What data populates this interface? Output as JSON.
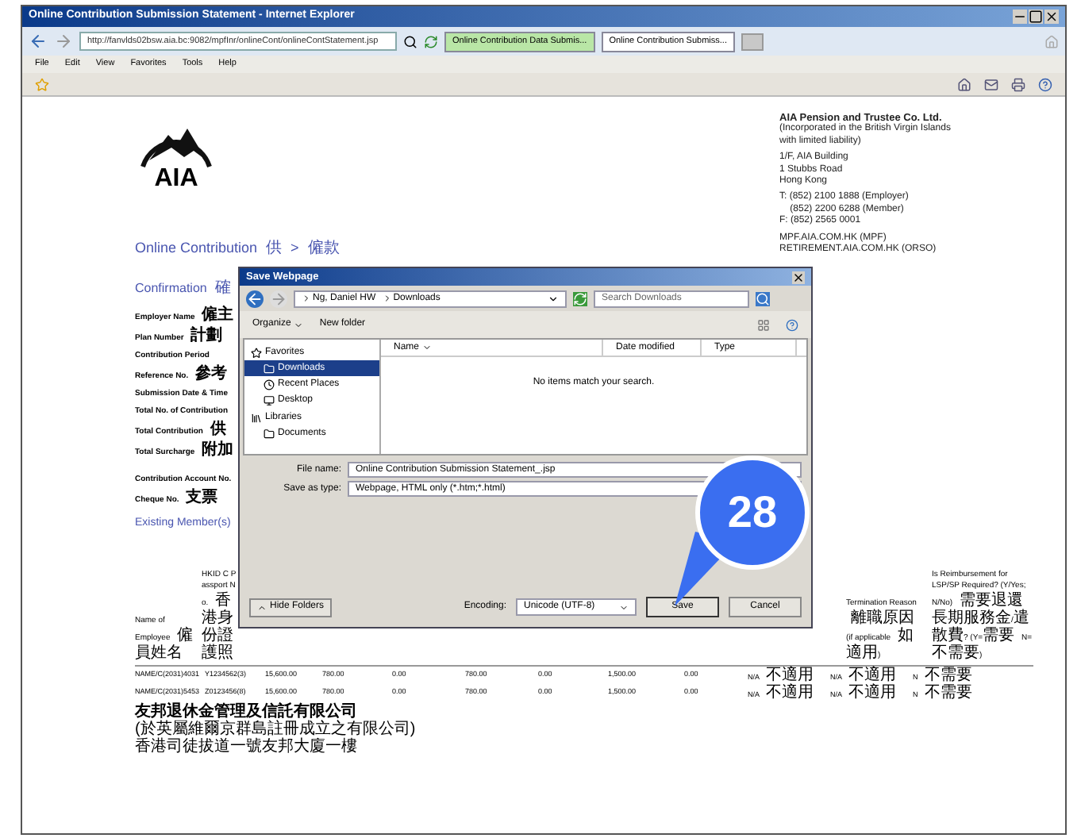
{
  "window": {
    "title": "Online Contribution Submission Statement - Internet Explorer"
  },
  "address_bar": {
    "url": "http://fanvlds02bsw.aia.bc:9082/mpfInr/onlineCont/onlineContStatement.jsp"
  },
  "tabs": [
    {
      "label": "Online Contribution Data Submis...",
      "selected": false
    },
    {
      "label": "Online Contribution Submiss...",
      "selected": true
    }
  ],
  "menu": [
    "File",
    "Edit",
    "View",
    "Favorites",
    "Tools",
    "Help"
  ],
  "page": {
    "logo_text": "AIA",
    "company": {
      "name": "AIA Pension and Trustee Co. Ltd.",
      "lines": [
        "(Incorporated in the British Virgin Islands",
        "with limited liability)",
        "1/F, AIA Building",
        "1 Stubbs Road",
        "Hong Kong",
        "T: (852) 2100 1888 (Employer)",
        "    (852) 2200 6288 (Member)",
        "F: (852) 2565 0001"
      ],
      "links": [
        "MPF.AIA.COM.HK (MPF)",
        "RETIREMENT.AIA.COM.HK (ORSO)"
      ]
    },
    "heading": "Online Contribution 供 > 僱款",
    "subheading": "Confirmation 確",
    "fields": [
      "Employer Name 僱主",
      "Plan Number 計劃",
      "Contribution Period",
      "Reference No. 參考",
      "Submission Date & Time",
      "Total No. of Contribution",
      "Total Contribution 供",
      "Total Surcharge 附加"
    ],
    "payment_fields": [
      "Contribution Account No.",
      "Cheque No. 支票"
    ],
    "section_title": "Existing Member(s)",
    "table": {
      "visible_headers": [
        "Name of Employee 僱員姓名",
        "HKID C Passport No. 香港身份證護照",
        "Termination Reason 離職原因 (if applicable 如適用)",
        "Is Reimbursement for LSP/SP Required? (Y/Yes; N/No) 需要退還長期服務金/遣散費? (Y=需要 N=不需要)"
      ],
      "rows": [
        [
          "NAME/C(2031)4031",
          "Y1234562(3)",
          "15,600.00",
          "780.00",
          "0.00",
          "780.00",
          "0.00",
          "1,500.00",
          "0.00",
          "N/A 不適用",
          "N/A 不適用",
          "N 不需要"
        ],
        [
          "NAME/C(2031)5453",
          "Z0123456(8)",
          "15,600.00",
          "780.00",
          "0.00",
          "780.00",
          "0.00",
          "1,500.00",
          "0.00",
          "N/A 不適用",
          "N/A 不適用",
          "N 不需要"
        ]
      ]
    },
    "footer_lines": [
      "友邦退休金管理及信託有限公司",
      "(於英屬維爾京群島註冊成立之有限公司)",
      "香港司徒拔道一號友邦大廈一樓"
    ]
  },
  "dialog": {
    "title": "Save Webpage",
    "path": [
      "Ng, Daniel HW",
      "Downloads"
    ],
    "search_placeholder": "Search Downloads",
    "toolbar": [
      "Organize",
      "New folder"
    ],
    "nav_items": [
      {
        "label": "Favorites",
        "kind": "group",
        "selected": false
      },
      {
        "label": "Downloads",
        "kind": "item",
        "selected": true
      },
      {
        "label": "Recent Places",
        "kind": "item",
        "selected": false
      },
      {
        "label": "Desktop",
        "kind": "item",
        "selected": false
      },
      {
        "label": "Libraries",
        "kind": "group",
        "selected": false
      },
      {
        "label": "Documents",
        "kind": "item",
        "selected": false
      }
    ],
    "columns": [
      "Name",
      "Date modified",
      "Type"
    ],
    "empty_message": "No items match your search.",
    "file_name_label": "File name:",
    "file_name": "Online Contribution Submission Statement_.jsp",
    "type_label": "Save as type:",
    "type_value": "Webpage, HTML only (*.htm;*.html)",
    "hide_folders": "Hide Folders",
    "encoding_label": "Encoding:",
    "encoding_value": "Unicode (UTF-8)",
    "buttons": [
      "Save",
      "Cancel"
    ]
  },
  "callout": {
    "number": "28"
  }
}
